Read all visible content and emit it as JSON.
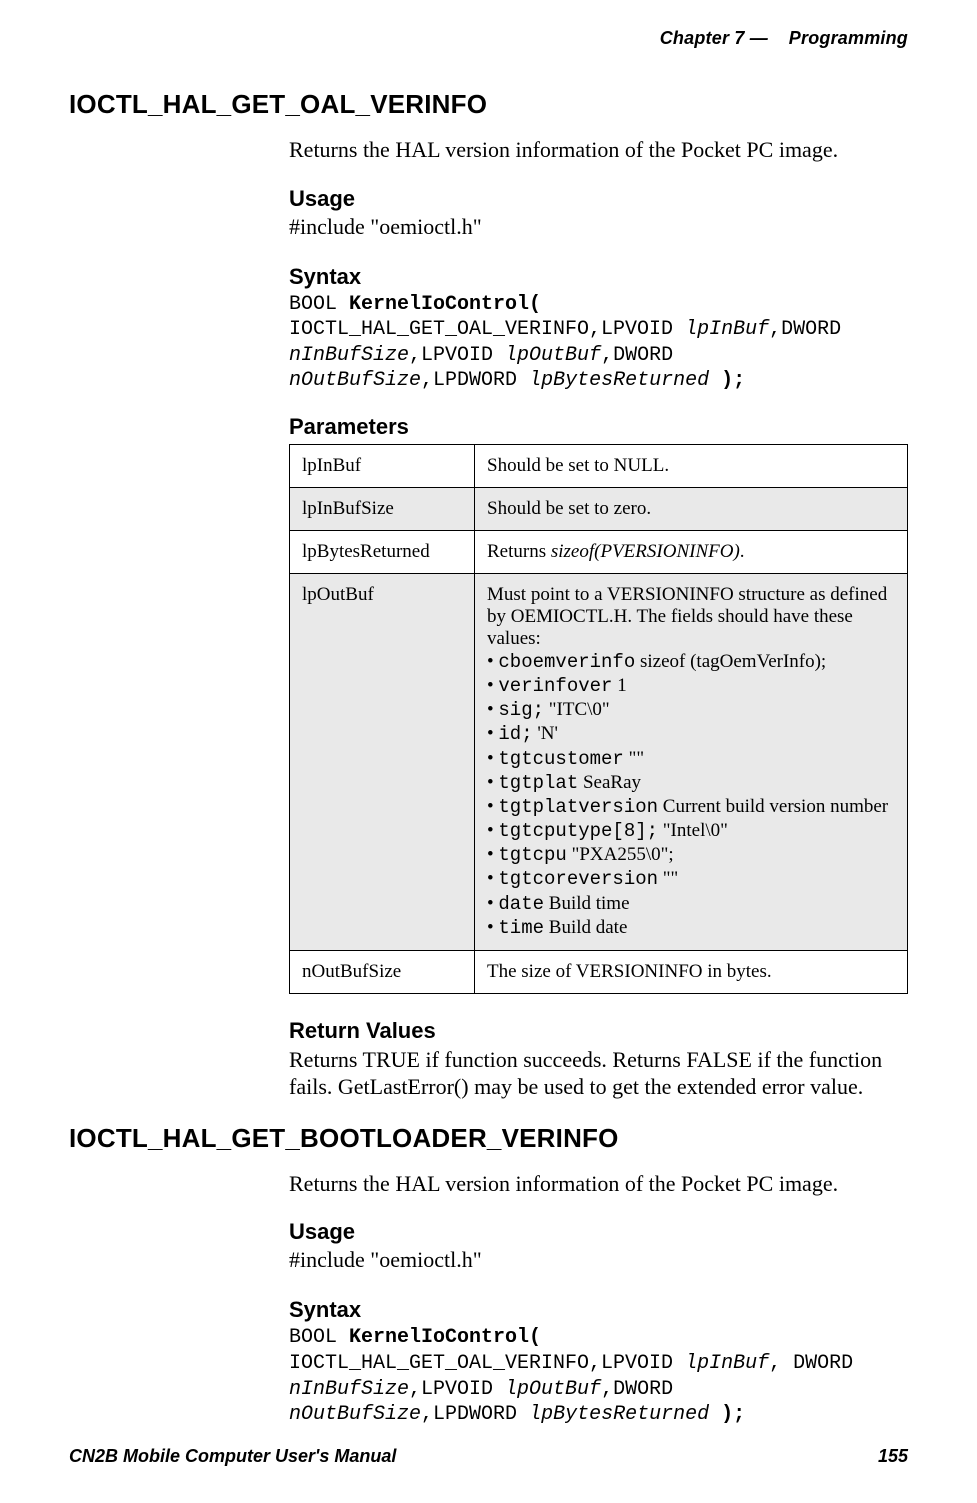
{
  "header": {
    "chapter": "Chapter 7 —",
    "title": "Programming"
  },
  "footer": {
    "manual": "CN2B Mobile Computer User's Manual",
    "page": "155"
  },
  "section1": {
    "heading": "IOCTL_HAL_GET_OAL_VERINFO",
    "intro": "Returns the HAL version information of the Pocket PC image.",
    "usage_h": "Usage",
    "usage_text": "#include \"oemioctl.h\"",
    "syntax_h": "Syntax",
    "syntax": {
      "prefix": "BOOL ",
      "func": "KernelIoControl(",
      "seg1": " IOCTL_HAL_GET_OAL_VERINFO,LPVOID ",
      "a1": "lpInBuf",
      "seg2": ",DWORD ",
      "a2": "nInBufSize",
      "seg3": ",LPVOID ",
      "a3": "lpOutBuf",
      "seg4": ",DWORD ",
      "a4": "nOutBufSize",
      "seg5": ",LPDWORD ",
      "a5": "lpBytesReturned",
      "end": " );"
    },
    "params_h": "Parameters",
    "params": {
      "r1": {
        "name": "lpInBuf",
        "desc": "Should be set to NULL."
      },
      "r2": {
        "name": "lpInBufSize",
        "desc": "Should be set to zero."
      },
      "r3": {
        "name": "lpBytesReturned",
        "desc_pre": "Returns ",
        "desc_em": "sizeof(PVERSIONINFO)",
        "desc_post": "."
      },
      "r4": {
        "name": "lpOutBuf",
        "lead": "Must point to a VERSIONINFO structure as defined by OEMIOCTL.H. The fields should have these values:",
        "items": {
          "i0": {
            "code": "cboemverinfo",
            "text": " sizeof (tagOemVerInfo);"
          },
          "i1": {
            "code": "verinfover",
            "text": " 1"
          },
          "i2": {
            "code": "sig;",
            "text": "  \"ITC\\0\""
          },
          "i3": {
            "code": "id;",
            "text": " 'N'"
          },
          "i4": {
            "code": "tgtcustomer",
            "text": " \"\""
          },
          "i5": {
            "code": "tgtplat",
            "text": " SeaRay"
          },
          "i6": {
            "code": "tgtplatversion",
            "text": " Current build version number"
          },
          "i7": {
            "code": "tgtcputype[8];",
            "text": "  \"Intel\\0\""
          },
          "i8": {
            "code": "tgtcpu",
            "text": " \"PXA255\\0\";"
          },
          "i9": {
            "code": "tgtcoreversion",
            "text": " \"\""
          },
          "i10": {
            "code": "date",
            "text": " Build time"
          },
          "i11": {
            "code": "time",
            "text": " Build date"
          }
        }
      },
      "r5": {
        "name": "nOutBufSize",
        "desc": "The size of VERSIONINFO in bytes."
      }
    },
    "return_h": "Return Values",
    "return_text": "Returns TRUE if function succeeds. Returns FALSE if the function fails. GetLastError() may be used to get the extended error value."
  },
  "section2": {
    "heading": "IOCTL_HAL_GET_BOOTLOADER_VERINFO",
    "intro": "Returns the HAL version information of the Pocket PC image.",
    "usage_h": "Usage",
    "usage_text": "#include \"oemioctl.h\"",
    "syntax_h": "Syntax",
    "syntax": {
      "prefix": "BOOL ",
      "func": "KernelIoControl(",
      "seg1": " IOCTL_HAL_GET_OAL_VERINFO,LPVOID ",
      "a1": "lpInBuf",
      "seg2": ", DWORD ",
      "a2": "nInBufSize",
      "seg3": ",LPVOID ",
      "a3": "lpOutBuf",
      "seg4": ",DWORD ",
      "a4": "nOutBufSize",
      "seg5": ",LPDWORD ",
      "a5": "lpBytesReturned",
      "end": " );"
    }
  }
}
